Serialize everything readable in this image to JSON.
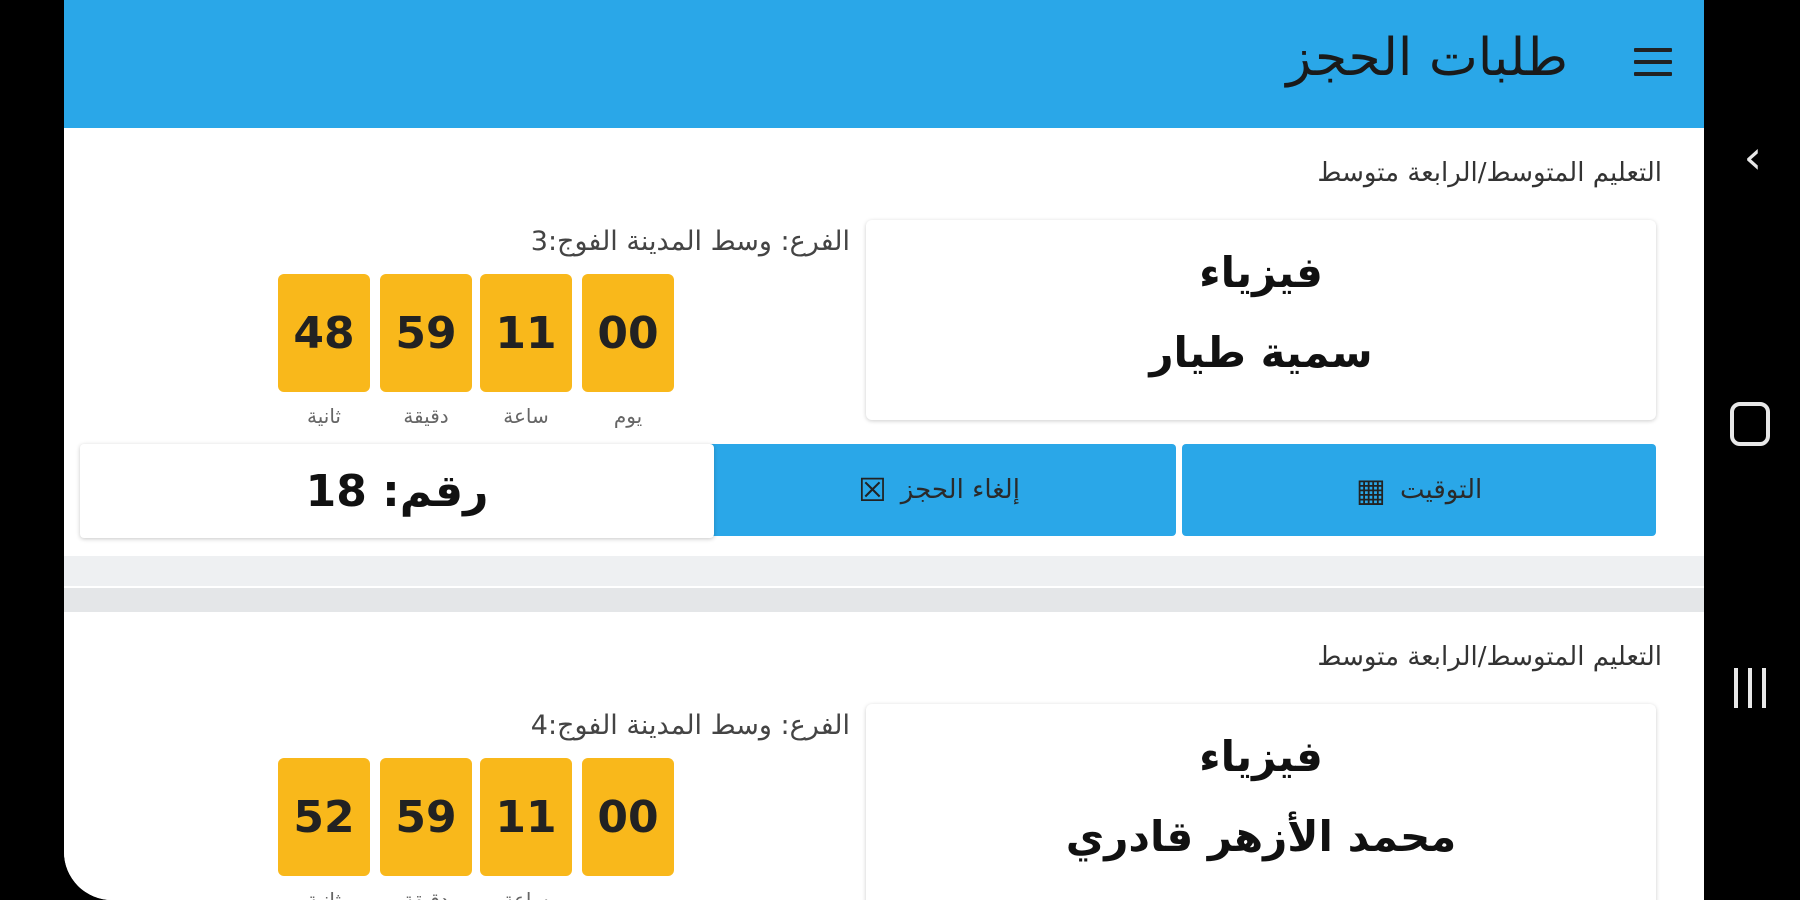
{
  "app": {
    "title": "طلبات الحجز"
  },
  "bookings": [
    {
      "level": "التعليم المتوسط/الرابعة متوسط",
      "branch_line": "الفرع: وسط المدينة  الفوج:3",
      "subject": "فيزياء",
      "teacher": "سمية طيار",
      "countdown": [
        {
          "value": "00",
          "label": "يوم"
        },
        {
          "value": "11",
          "label": "ساعة"
        },
        {
          "value": "59",
          "label": "دقيقة"
        },
        {
          "value": "48",
          "label": "ثانية"
        }
      ],
      "schedule_label": "التوقيت",
      "cancel_label": "إلغاء الحجز",
      "number_text": "رقم: 18"
    },
    {
      "level": "التعليم المتوسط/الرابعة متوسط",
      "branch_line": "الفرع: وسط المدينة  الفوج:4",
      "subject": "فيزياء",
      "teacher": "محمد الأزهر قادري",
      "countdown": [
        {
          "value": "00",
          "label": "يوم"
        },
        {
          "value": "11",
          "label": "ساعة"
        },
        {
          "value": "59",
          "label": "دقيقة"
        },
        {
          "value": "52",
          "label": "ثانية"
        }
      ]
    }
  ],
  "icons": {
    "menu": "hamburger-menu-icon",
    "schedule": "calendar-icon",
    "cancel": "close-box-icon",
    "back": "chevron-left-icon",
    "home": "home-icon",
    "recents": "recent-apps-icon"
  },
  "colors": {
    "appbar": "#2aa7e8",
    "countdown_box": "#f9b81b",
    "button": "#2aa7e8"
  }
}
